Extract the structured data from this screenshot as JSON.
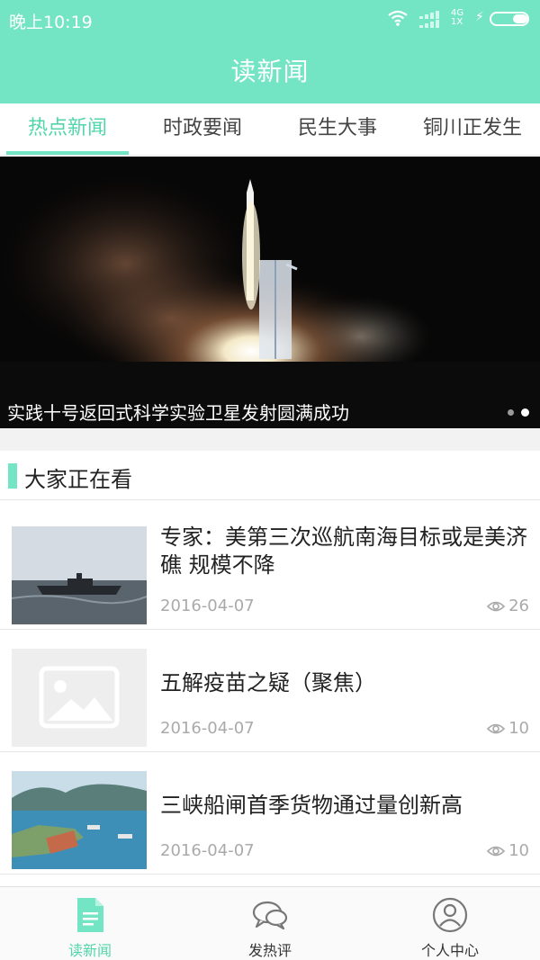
{
  "status_bar": {
    "time": "晚上10:19",
    "network_signal_text": "4G",
    "network_secondary_text": "1X"
  },
  "app": {
    "title": "读新闻",
    "accent_color": "#74e5c4"
  },
  "tabs": [
    {
      "label": "热点新闻",
      "active": true
    },
    {
      "label": "时政要闻",
      "active": false
    },
    {
      "label": "民生大事",
      "active": false
    },
    {
      "label": "铜川正发生",
      "active": false
    }
  ],
  "banner": {
    "caption": "实践十号返回式科学实验卫星发射圆满成功",
    "image_icon": "rocket-launch-image",
    "slide_count": 2,
    "active_slide": 2
  },
  "section": {
    "title": "大家正在看"
  },
  "news": [
    {
      "headline": "专家：美第三次巡航南海目标或是美济礁 规模不降",
      "date": "2016-04-07",
      "views": "26",
      "thumb_icon": "ship-photo"
    },
    {
      "headline": "五解疫苗之疑（聚焦）",
      "date": "2016-04-07",
      "views": "10",
      "thumb_icon": "image-placeholder-icon"
    },
    {
      "headline": "三峡船闸首季货物通过量创新高",
      "date": "2016-04-07",
      "views": "10",
      "thumb_icon": "river-locks-photo"
    }
  ],
  "bottom_nav": [
    {
      "label": "读新闻",
      "icon": "document-icon",
      "active": true
    },
    {
      "label": "发热评",
      "icon": "chat-bubbles-icon",
      "active": false
    },
    {
      "label": "个人中心",
      "icon": "user-circle-icon",
      "active": false
    }
  ]
}
